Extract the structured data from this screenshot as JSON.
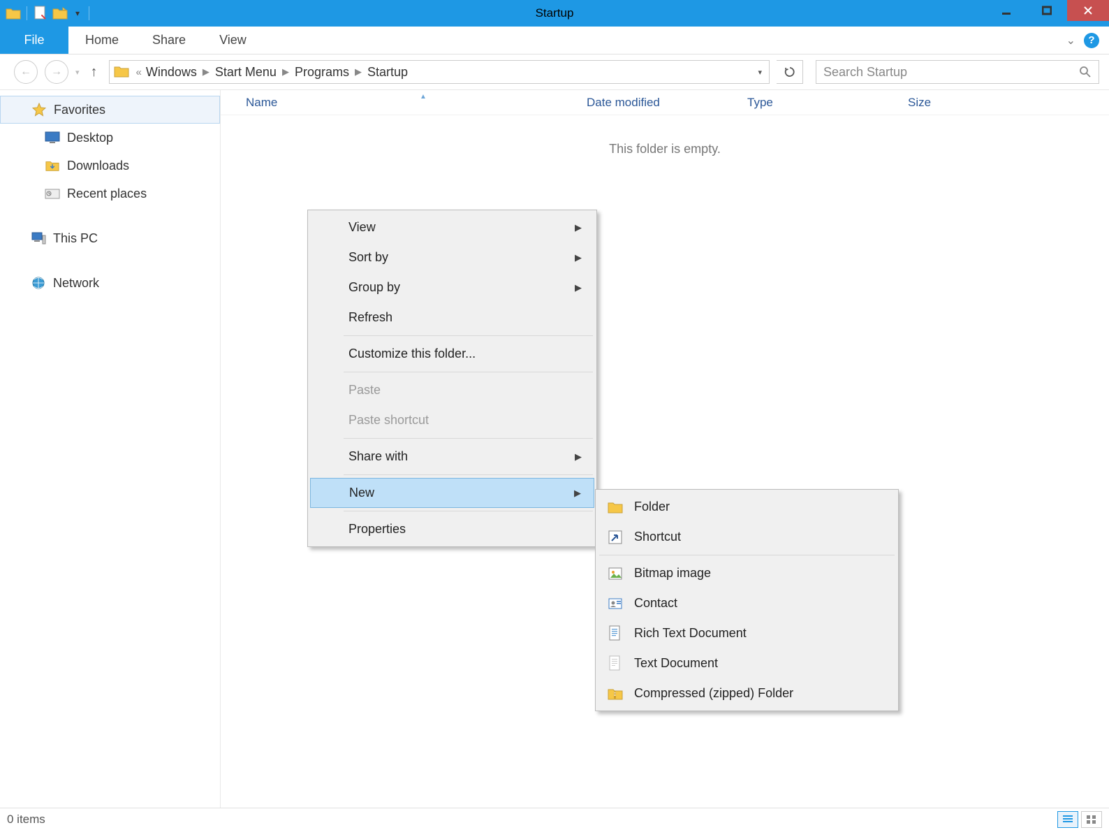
{
  "window": {
    "title": "Startup"
  },
  "ribbon": {
    "file": "File",
    "tabs": [
      "Home",
      "Share",
      "View"
    ]
  },
  "address": {
    "segments": [
      "Windows",
      "Start Menu",
      "Programs",
      "Startup"
    ]
  },
  "search": {
    "placeholder": "Search Startup"
  },
  "navpane": {
    "favorites": "Favorites",
    "desktop": "Desktop",
    "downloads": "Downloads",
    "recent": "Recent places",
    "thispc": "This PC",
    "network": "Network"
  },
  "columns": {
    "name": "Name",
    "date": "Date modified",
    "type": "Type",
    "size": "Size"
  },
  "empty": "This folder is empty.",
  "context": {
    "view": "View",
    "sortby": "Sort by",
    "groupby": "Group by",
    "refresh": "Refresh",
    "customize": "Customize this folder...",
    "paste": "Paste",
    "pasteshortcut": "Paste shortcut",
    "sharewith": "Share with",
    "new": "New",
    "properties": "Properties"
  },
  "submenu": {
    "folder": "Folder",
    "shortcut": "Shortcut",
    "bitmap": "Bitmap image",
    "contact": "Contact",
    "rtf": "Rich Text Document",
    "txt": "Text Document",
    "zip": "Compressed (zipped) Folder"
  },
  "status": {
    "items": "0 items"
  }
}
